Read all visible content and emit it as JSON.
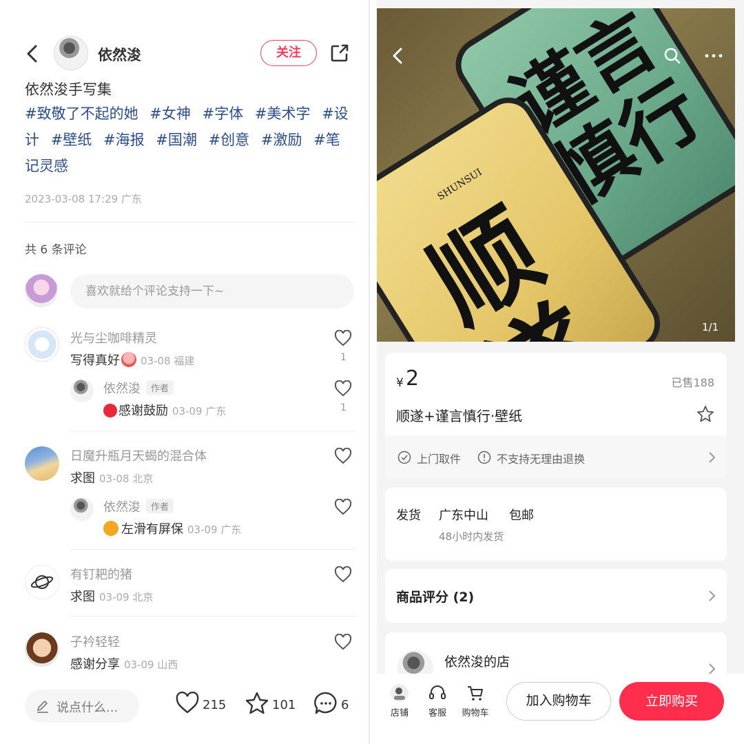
{
  "left": {
    "header": {
      "author_name": "依然浚",
      "follow_label": "关注"
    },
    "post": {
      "title": "依然浚手写集",
      "tags": [
        "#致敬了不起的她",
        "#女神",
        "#字体",
        "#美术字",
        "#设计",
        "#壁纸",
        "#海报",
        "#国潮",
        "#创意",
        "#激励",
        "#笔记灵感"
      ],
      "meta": "2023-03-08 17:29 广东"
    },
    "comments_header": "共 6 条评论",
    "comment_input_placeholder": "喜欢就给个评论支持一下~",
    "comments": [
      {
        "name": "光与尘咖啡精灵",
        "text": "写得真好",
        "meta": "03-08 福建",
        "likes": "1"
      },
      {
        "name": "依然浚",
        "badge": "作者",
        "text": "感谢鼓励",
        "meta": "03-09 广东",
        "likes": "1"
      },
      {
        "name": "日魔升瓶月天蝎的混合体",
        "text": "求图",
        "meta": "03-08 北京"
      },
      {
        "name": "依然浚",
        "badge": "作者",
        "text": "左滑有屏保",
        "meta": "03-09 广东"
      },
      {
        "name": "有钉耙的猪",
        "text": "求图",
        "meta": "03-09 北京"
      },
      {
        "name": "子衿轻轻",
        "text": "感谢分享",
        "meta": "03-09 山西"
      }
    ],
    "bottom": {
      "say_label": "说点什么...",
      "likes": "215",
      "collects": "101",
      "comments": "6"
    }
  },
  "right": {
    "image_counter": "1/1",
    "hero_art": {
      "phone_top_brush": "谨言慎行",
      "phone_bottom_brush": "顺遂",
      "phone_bottom_roman": "SHUNSUI"
    },
    "product": {
      "price_symbol": "¥",
      "price": "2",
      "sold": "已售188",
      "title": "顺遂+谨言慎行·壁纸",
      "service1": "上门取件",
      "service2": "不支持无理由退换"
    },
    "shipping": {
      "label": "发货",
      "city": "广东中山",
      "free": "包邮",
      "time": "48小时内发货"
    },
    "reviews_title": "商品评分 (2)",
    "store_name": "依然浚的店",
    "bottom": {
      "store": "店铺",
      "service": "客服",
      "cart": "购物车",
      "add_to_cart": "加入购物车",
      "buy_now": "立即购买"
    }
  },
  "colors": {
    "accent": "#ff2e4d",
    "tag_blue": "#2b4d8c",
    "follow_red": "#ff3b5c"
  }
}
